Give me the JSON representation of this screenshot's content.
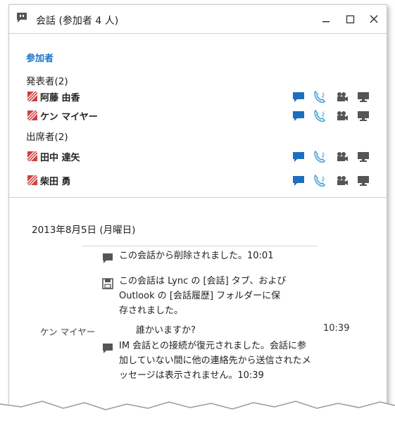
{
  "window": {
    "title": "会話 (参加者 4 人)",
    "buttons": {
      "minimize": "minimize-icon",
      "maximize": "maximize-icon",
      "close": "close-icon"
    }
  },
  "participants": {
    "heading": "参加者",
    "presenters_label": "発表者(2)",
    "attendees_label": "出席者(2)",
    "presenters": [
      {
        "name": "阿藤 由香"
      },
      {
        "name": "ケン マイヤー"
      }
    ],
    "attendees": [
      {
        "name": "田中 達矢"
      },
      {
        "name": "柴田 勇"
      }
    ],
    "action_icons": [
      "im-icon",
      "phone-icon",
      "video-icon",
      "desktop-share-icon"
    ]
  },
  "conversation": {
    "date": "2013年8月5日 (月曜日)",
    "messages": [
      {
        "icon": "chat-bubble-icon",
        "lines": [
          "この会話から削除されました。10:01"
        ]
      },
      {
        "icon": "save-icon",
        "lines": [
          "この会話は Lync の [会話] タブ、および",
          "Outlook の [会話履歴] フォルダーに保",
          "存されました。"
        ]
      },
      {
        "sender": "ケン マイヤー",
        "text": "誰かいますか?",
        "time": "10:39"
      },
      {
        "icon": "chat-bubble-icon",
        "lines": [
          "IM 会話との接続が復元されました。会話に参",
          "加していない間に他の連絡先から送信されたメ",
          "ッセージは表示されません。10:39"
        ]
      }
    ]
  },
  "colors": {
    "accent": "#1a73c8",
    "im_blue": "#1d6fc0",
    "phone_blue": "#4aa3df",
    "flag_red": "#d04040",
    "icon_gray": "#555555"
  }
}
